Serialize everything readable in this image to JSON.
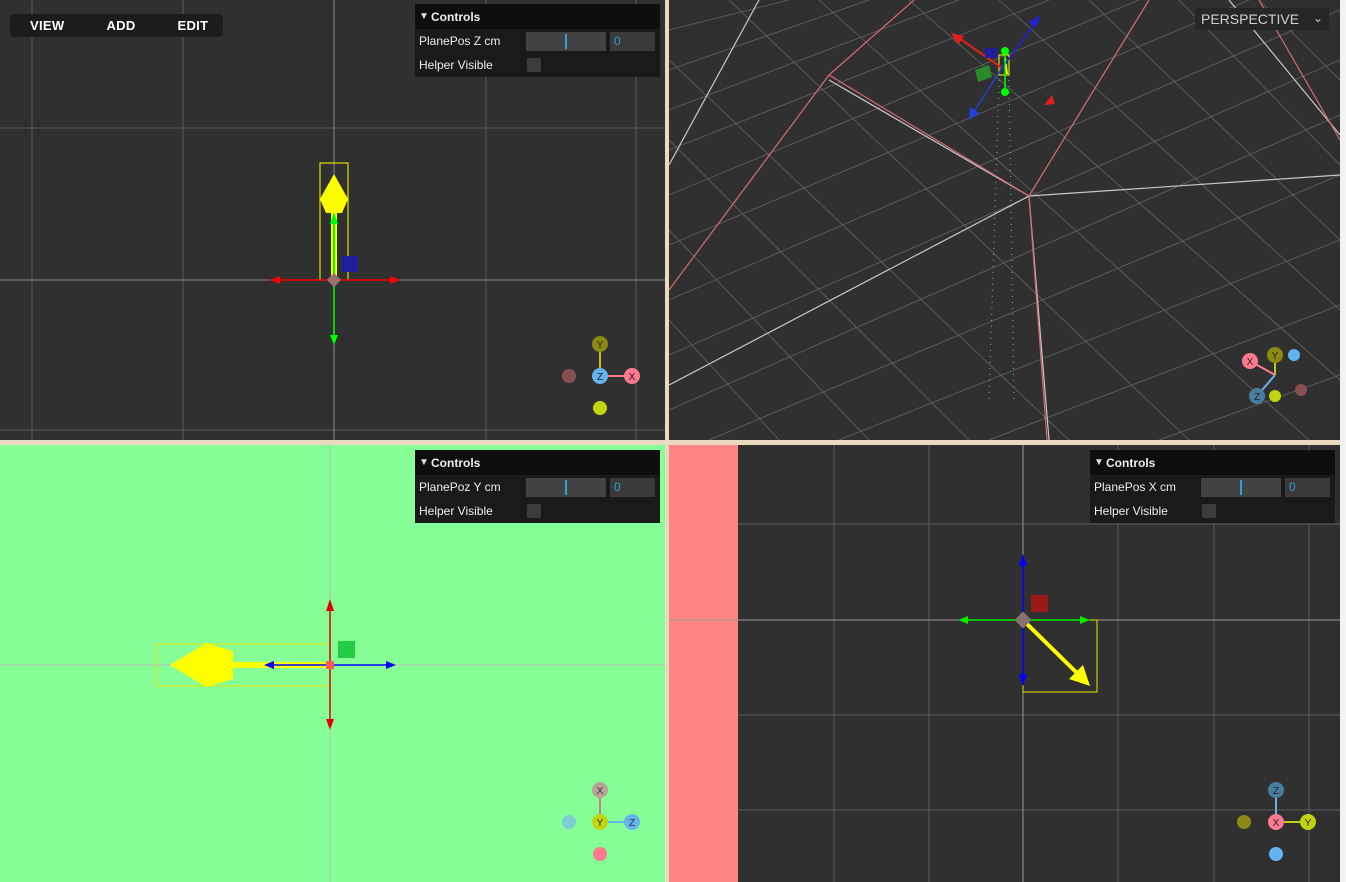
{
  "menu": {
    "items": [
      "VIEW",
      "ADD",
      "EDIT"
    ]
  },
  "viewports": {
    "top": {
      "controls": {
        "title": "Controls",
        "slider_label": "PlanePos Z cm",
        "value": "0",
        "checkbox_label": "Helper Visible"
      },
      "gizmo": {
        "up": "Y",
        "center": "Z",
        "right": "X"
      }
    },
    "perspective": {
      "camera": "PERSPECTIVE",
      "gizmo": {
        "x": "X",
        "y": "Y",
        "z": "Z"
      }
    },
    "front": {
      "controls": {
        "title": "Controls",
        "slider_label": "PlanePoz Y cm",
        "value": "0",
        "checkbox_label": "Helper Visible"
      },
      "gizmo": {
        "up": "X",
        "center": "Y",
        "right": "Z"
      }
    },
    "side": {
      "controls": {
        "title": "Controls",
        "slider_label": "PlanePos X cm",
        "value": "0",
        "checkbox_label": "Helper Visible"
      },
      "gizmo": {
        "up": "Z",
        "center": "X",
        "right": "Y"
      }
    }
  },
  "colors": {
    "viewport_bg": "#303030",
    "front_bg": "#87ff97",
    "side_strip": "#ff8585",
    "axis_x": "#ff0000",
    "axis_y": "#00ff00",
    "axis_z": "#0000ff",
    "selection": "#ffff00",
    "gizmo_x": "#ff7a8e",
    "gizmo_y": "#c2d40f",
    "gizmo_z": "#63b3f0"
  }
}
